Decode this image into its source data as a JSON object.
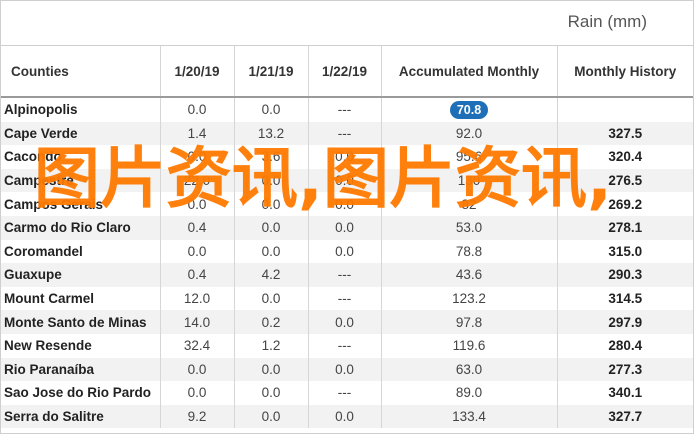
{
  "title": "Rain (mm)",
  "headers": {
    "counties": "Counties",
    "d1": "1/20/19",
    "d2": "1/21/19",
    "d3": "1/22/19",
    "accumulated": "Accumulated Monthly",
    "monthly": "Monthly History"
  },
  "rows": [
    {
      "county": "Alpinopolis",
      "d1": "0.0",
      "d2": "0.0",
      "d3": "---",
      "acc": "70.8",
      "monthly": ""
    },
    {
      "county": "Cape Verde",
      "d1": "1.4",
      "d2": "13.2",
      "d3": "---",
      "acc": "92.0",
      "monthly": "327.5"
    },
    {
      "county": "Cacondo",
      "d1": "0.0",
      "d2": "3.6",
      "d3": "0.0",
      "acc": "95.6",
      "monthly": "320.4"
    },
    {
      "county": "Campestre",
      "d1": "22.0",
      "d2": "0.0",
      "d3": "0.0",
      "acc": "130",
      "monthly": "276.5"
    },
    {
      "county": "Campos Gerais",
      "d1": "0.0",
      "d2": "0.0",
      "d3": "0.0",
      "acc": "82",
      "monthly": "269.2"
    },
    {
      "county": "Carmo do Rio Claro",
      "d1": "0.4",
      "d2": "0.0",
      "d3": "0.0",
      "acc": "53.0",
      "monthly": "278.1"
    },
    {
      "county": "Coromandel",
      "d1": "0.0",
      "d2": "0.0",
      "d3": "0.0",
      "acc": "78.8",
      "monthly": "315.0"
    },
    {
      "county": "Guaxupe",
      "d1": "0.4",
      "d2": "4.2",
      "d3": "---",
      "acc": "43.6",
      "monthly": "290.3"
    },
    {
      "county": "Mount Carmel",
      "d1": "12.0",
      "d2": "0.0",
      "d3": "---",
      "acc": "123.2",
      "monthly": "314.5"
    },
    {
      "county": "Monte Santo de Minas",
      "d1": "14.0",
      "d2": "0.2",
      "d3": "0.0",
      "acc": "97.8",
      "monthly": "297.9"
    },
    {
      "county": "New Resende",
      "d1": "32.4",
      "d2": "1.2",
      "d3": "---",
      "acc": "119.6",
      "monthly": "280.4"
    },
    {
      "county": "Rio Paranaíba",
      "d1": "0.0",
      "d2": "0.0",
      "d3": "0.0",
      "acc": "63.0",
      "monthly": "277.3"
    },
    {
      "county": "Sao Jose do Rio Pardo",
      "d1": "0.0",
      "d2": "0.0",
      "d3": "---",
      "acc": "89.0",
      "monthly": "340.1"
    },
    {
      "county": "Serra do Salitre",
      "d1": "9.2",
      "d2": "0.0",
      "d3": "0.0",
      "acc": "133.4",
      "monthly": "327.7"
    }
  ],
  "watermark": "图片资讯,图片资讯,"
}
